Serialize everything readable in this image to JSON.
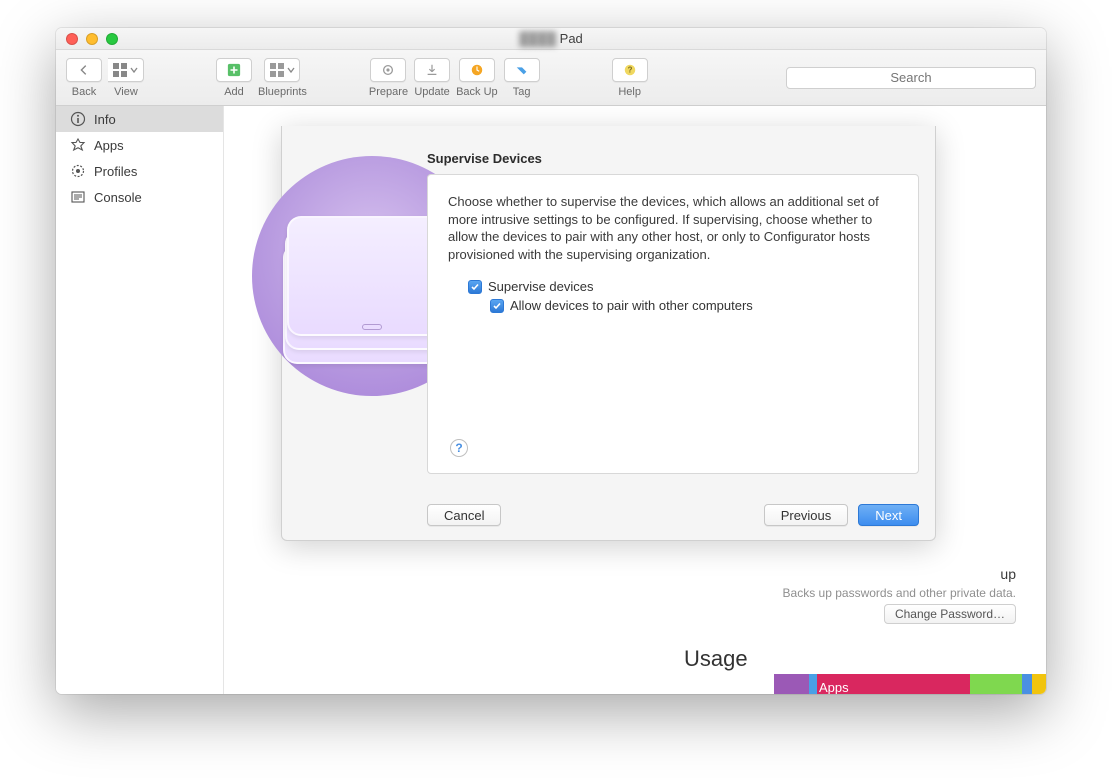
{
  "window": {
    "title_prefix": "████",
    "title_suffix": "Pad"
  },
  "toolbar": {
    "back": "Back",
    "view": "View",
    "add": "Add",
    "blueprints": "Blueprints",
    "prepare": "Prepare",
    "update": "Update",
    "backup": "Back Up",
    "tag": "Tag",
    "help": "Help",
    "search_placeholder": "Search"
  },
  "sidebar": {
    "items": [
      {
        "label": "Info",
        "icon": "info",
        "active": true
      },
      {
        "label": "Apps",
        "icon": "apps",
        "active": false
      },
      {
        "label": "Profiles",
        "icon": "profiles",
        "active": false
      },
      {
        "label": "Console",
        "icon": "console",
        "active": false
      }
    ]
  },
  "sheet": {
    "title": "Supervise Devices",
    "description": "Choose whether to supervise the devices, which allows an additional set of more intrusive settings to be configured. If supervising, choose whether to allow the devices to pair with any other host, or only to Configurator hosts provisioned with the supervising organization.",
    "checkbox_supervise": "Supervise devices",
    "checkbox_pair": "Allow devices to pair with other computers",
    "help_glyph": "?",
    "cancel": "Cancel",
    "previous": "Previous",
    "next": "Next"
  },
  "background": {
    "encrypt_label": "up",
    "encrypt_desc": "Backs up passwords and other private data.",
    "change_password": "Change Password…",
    "usage_title": "Usage",
    "usage_apps": "Apps"
  },
  "colors": {
    "accent": "#3d8def",
    "usage_segments": [
      "#9b59b6",
      "#4aa0e6",
      "#d9275f",
      "#7fd84f",
      "#4a90e2",
      "#f1c40f"
    ]
  }
}
